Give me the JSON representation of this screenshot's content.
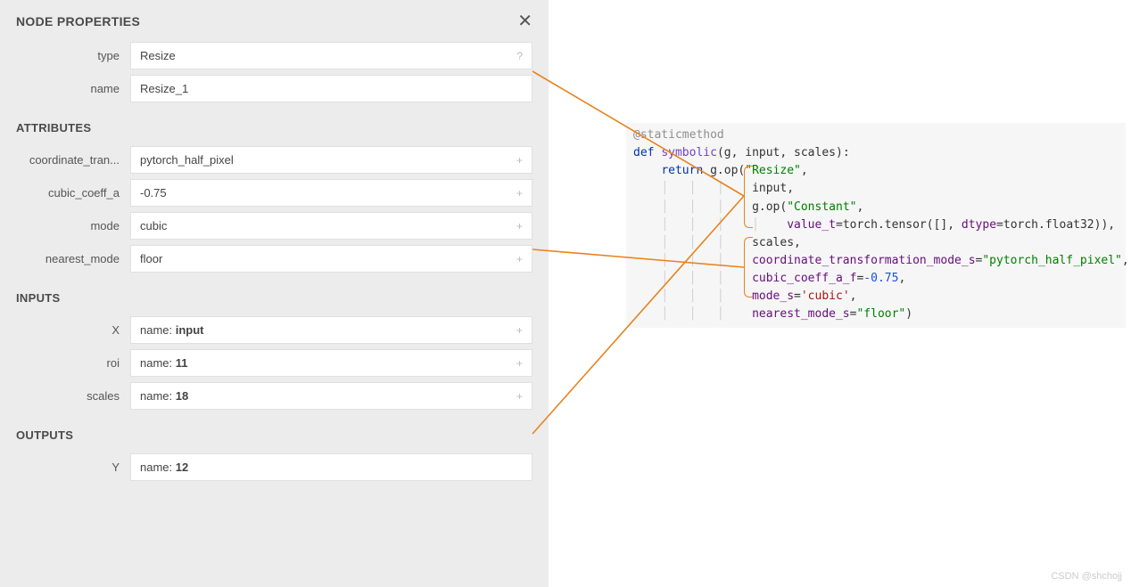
{
  "panel": {
    "title": "NODE PROPERTIES",
    "close_glyph": "✕",
    "fields": {
      "type": {
        "label": "type",
        "value": "Resize",
        "suffix": "?"
      },
      "name": {
        "label": "name",
        "value": "Resize_1"
      }
    },
    "attributes": {
      "title": "ATTRIBUTES",
      "items": [
        {
          "label": "coordinate_tran...",
          "value": "pytorch_half_pixel",
          "suffix": "+"
        },
        {
          "label": "cubic_coeff_a",
          "value": "-0.75",
          "suffix": "+"
        },
        {
          "label": "mode",
          "value": "cubic",
          "suffix": "+"
        },
        {
          "label": "nearest_mode",
          "value": "floor",
          "suffix": "+"
        }
      ]
    },
    "inputs": {
      "title": "INPUTS",
      "items": [
        {
          "label": "X",
          "prefix": "name: ",
          "bold": "input",
          "suffix": "+"
        },
        {
          "label": "roi",
          "prefix": "name: ",
          "bold": "11",
          "suffix": "+"
        },
        {
          "label": "scales",
          "prefix": "name: ",
          "bold": "18",
          "suffix": "+"
        }
      ]
    },
    "outputs": {
      "title": "OUTPUTS",
      "items": [
        {
          "label": "Y",
          "prefix": "name: ",
          "bold": "12"
        }
      ]
    }
  },
  "code": {
    "decorator": "@staticmethod",
    "def_kw": "def",
    "fn_name": "symbolic",
    "params": "(g, input, scales):",
    "return_kw": "return",
    "gop1": "g.op(",
    "str_resize": "\"Resize\"",
    "comma": ",",
    "arg_input": "input,",
    "gop2": "g.op(",
    "str_constant": "\"Constant\"",
    "value_t": "value_t",
    "equals": "=",
    "torch": "torch",
    "dot": ".",
    "tensor": "tensor",
    "tensor_args": "([], ",
    "dtype": "dtype",
    "float32": "float32)),",
    "arg_scales": "scales,",
    "coord_mode": "coordinate_transformation_mode_s",
    "coord_val": "\"pytorch_half_pixel\"",
    "cubic": "cubic_coeff_a_f",
    "cubic_val": "-0.75",
    "mode": "mode_s",
    "mode_val": "'cubic'",
    "nearest": "nearest_mode_s",
    "nearest_val": "\"floor\"",
    "close_paren": ")"
  },
  "watermark": "CSDN @shchojj"
}
